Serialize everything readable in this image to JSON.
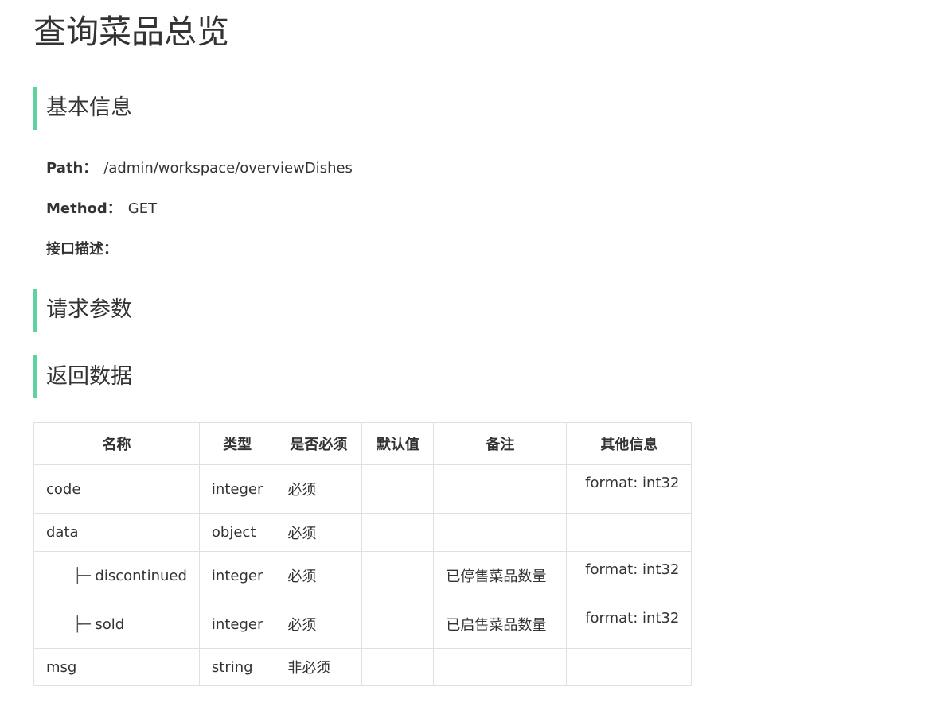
{
  "page": {
    "title": "查询菜品总览"
  },
  "sections": {
    "basic_info": "基本信息",
    "request_params": "请求参数",
    "return_data": "返回数据"
  },
  "basic_info": {
    "path_label": "Path：",
    "path_value": "/admin/workspace/overviewDishes",
    "method_label": "Method：",
    "method_value": "GET",
    "desc_label": "接口描述："
  },
  "table": {
    "headers": [
      "名称",
      "类型",
      "是否必须",
      "默认值",
      "备注",
      "其他信息"
    ],
    "rows": [
      {
        "prefix": "",
        "name": "code",
        "type": "integer",
        "required": "必须",
        "default": "",
        "remark": "",
        "other": "format: int32"
      },
      {
        "prefix": "",
        "name": "data",
        "type": "object",
        "required": "必须",
        "default": "",
        "remark": "",
        "other": ""
      },
      {
        "prefix": "├─ ",
        "name": "discontinued",
        "type": "integer",
        "required": "必须",
        "default": "",
        "remark": "已停售菜品数量",
        "other": "format: int32"
      },
      {
        "prefix": "├─ ",
        "name": "sold",
        "type": "integer",
        "required": "必须",
        "default": "",
        "remark": "已启售菜品数量",
        "other": "format: int32"
      },
      {
        "prefix": "",
        "name": "msg",
        "type": "string",
        "required": "非必须",
        "default": "",
        "remark": "",
        "other": ""
      }
    ]
  },
  "colors": {
    "accent": "#5fd2a0",
    "text": "#333333",
    "border": "#e0e0e0"
  }
}
